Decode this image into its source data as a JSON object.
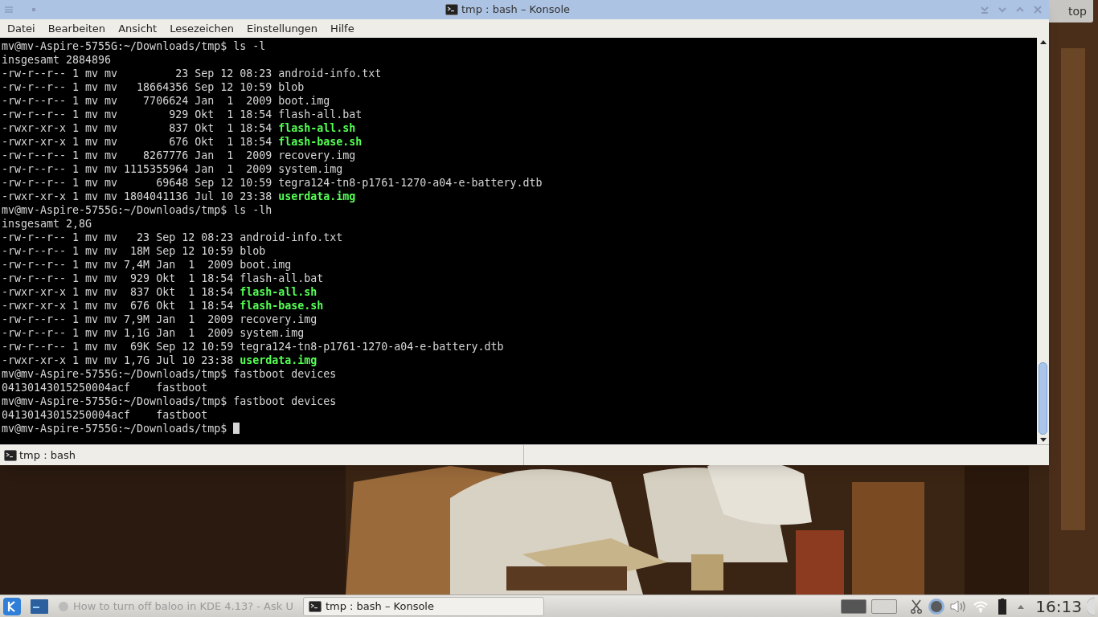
{
  "window": {
    "title": "tmp : bash – Konsole"
  },
  "background_window": {
    "title": "top"
  },
  "menu": [
    "Datei",
    "Bearbeiten",
    "Ansicht",
    "Lesezeichen",
    "Einstellungen",
    "Hilfe"
  ],
  "terminal": {
    "lines": [
      {
        "text": "mv@mv-Aspire-5755G:~/Downloads/tmp$ ls -l"
      },
      {
        "text": "insgesamt 2884896"
      },
      {
        "text": "-rw-r--r-- 1 mv mv         23 Sep 12 08:23 android-info.txt"
      },
      {
        "text": "-rw-r--r-- 1 mv mv   18664356 Sep 12 10:59 blob"
      },
      {
        "text": "-rw-r--r-- 1 mv mv    7706624 Jan  1  2009 boot.img"
      },
      {
        "text": "-rw-r--r-- 1 mv mv        929 Okt  1 18:54 flash-all.bat"
      },
      {
        "text": "-rwxr-xr-x 1 mv mv        837 Okt  1 18:54 ",
        "executable_name": "flash-all.sh"
      },
      {
        "text": "-rwxr-xr-x 1 mv mv        676 Okt  1 18:54 ",
        "executable_name": "flash-base.sh"
      },
      {
        "text": "-rw-r--r-- 1 mv mv    8267776 Jan  1  2009 recovery.img"
      },
      {
        "text": "-rw-r--r-- 1 mv mv 1115355964 Jan  1  2009 system.img"
      },
      {
        "text": "-rw-r--r-- 1 mv mv      69648 Sep 12 10:59 tegra124-tn8-p1761-1270-a04-e-battery.dtb"
      },
      {
        "text": "-rwxr-xr-x 1 mv mv 1804041136 Jul 10 23:38 ",
        "executable_name": "userdata.img"
      },
      {
        "text": "mv@mv-Aspire-5755G:~/Downloads/tmp$ ls -lh"
      },
      {
        "text": "insgesamt 2,8G"
      },
      {
        "text": "-rw-r--r-- 1 mv mv   23 Sep 12 08:23 android-info.txt"
      },
      {
        "text": "-rw-r--r-- 1 mv mv  18M Sep 12 10:59 blob"
      },
      {
        "text": "-rw-r--r-- 1 mv mv 7,4M Jan  1  2009 boot.img"
      },
      {
        "text": "-rw-r--r-- 1 mv mv  929 Okt  1 18:54 flash-all.bat"
      },
      {
        "text": "-rwxr-xr-x 1 mv mv  837 Okt  1 18:54 ",
        "executable_name": "flash-all.sh"
      },
      {
        "text": "-rwxr-xr-x 1 mv mv  676 Okt  1 18:54 ",
        "executable_name": "flash-base.sh"
      },
      {
        "text": "-rw-r--r-- 1 mv mv 7,9M Jan  1  2009 recovery.img"
      },
      {
        "text": "-rw-r--r-- 1 mv mv 1,1G Jan  1  2009 system.img"
      },
      {
        "text": "-rw-r--r-- 1 mv mv  69K Sep 12 10:59 tegra124-tn8-p1761-1270-a04-e-battery.dtb"
      },
      {
        "text": "-rwxr-xr-x 1 mv mv 1,7G Jul 10 23:38 ",
        "executable_name": "userdata.img"
      },
      {
        "text": "mv@mv-Aspire-5755G:~/Downloads/tmp$ fastboot devices"
      },
      {
        "text": "04130143015250004acf\tfastboot"
      },
      {
        "text": "mv@mv-Aspire-5755G:~/Downloads/tmp$ fastboot devices"
      },
      {
        "text": "04130143015250004acf\tfastboot"
      },
      {
        "text": "mv@mv-Aspire-5755G:~/Downloads/tmp$ ",
        "cursor": true
      }
    ]
  },
  "tabs": [
    {
      "label": "tmp : bash",
      "selected": true
    }
  ],
  "taskbar": {
    "tasks": [
      {
        "label": "How to turn off baloo in KDE 4.13? - Ask U",
        "selected": false
      },
      {
        "label": "tmp : bash – Konsole",
        "selected": true
      }
    ],
    "desktops": [
      {
        "selected": true
      },
      {
        "selected": false
      }
    ],
    "clock": "16:13"
  }
}
